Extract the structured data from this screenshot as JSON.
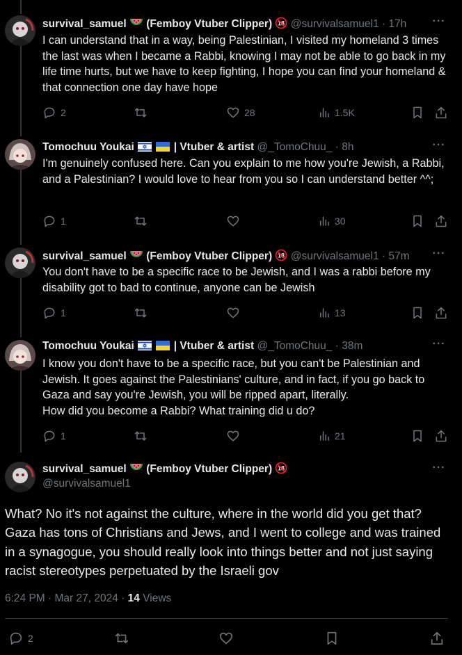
{
  "tweets": [
    {
      "name": "survival_samuel",
      "name_suffix": "(Femboy Vtuber Clipper)",
      "handle": "@survivalsamuel1",
      "time": "17h",
      "text": "I can understand that in a way, being Palestinian, I visited my homeland 3 times the last was when I became a Rabbi, knowing I may not be able to go back in my life time hurts, but  we have to keep fighting, I hope you can find your homeland & that connection one day have hope",
      "replies": "2",
      "likes": "28",
      "views": "1.5K"
    },
    {
      "name": "Tomochuu Youkai",
      "name_suffix": "| Vtuber & artist",
      "handle": "@_TomoChuu_",
      "time": "8h",
      "text": "I'm genuinely confused here. Can you explain to me how you're Jewish, a Rabbi, and a Palestinian? I would love to hear from you so I can understand better ^^;",
      "replies": "1",
      "likes": "",
      "views": "30"
    },
    {
      "name": "survival_samuel",
      "name_suffix": "(Femboy Vtuber Clipper)",
      "handle": "@survivalsamuel1",
      "time": "57m",
      "text": "You don't have to be a specific race to be Jewish, and I was a rabbi before my disability got to bad to continue, anyone can be Jewish",
      "replies": "1",
      "likes": "",
      "views": "13"
    },
    {
      "name": "Tomochuu Youkai",
      "name_suffix": "| Vtuber & artist",
      "handle": "@_TomoChuu_",
      "time": "38m",
      "text": "I know you don't have to be a specific race, but you can't be Palestinian and Jewish. It goes against the Palestinians' culture, and in fact, if you go back to Gaza and say you're Jewish, you will be ripped apart, literally.\nHow did you become a Rabbi? What training did u do?",
      "replies": "1",
      "likes": "",
      "views": "21"
    }
  ],
  "main_tweet": {
    "name": "survival_samuel",
    "name_suffix": "(Femboy Vtuber Clipper)",
    "handle": "@survivalsamuel1",
    "text": "What? No it's not against the culture, where in the world did you get that? Gaza has tons of Christians and Jews, and I went to college and was trained in a synagogue, you should really look into things better and not just saying racist stereotypes perpetuated by the Israeli gov",
    "timestamp": "6:24 PM · Mar 27, 2024",
    "views_count": "14",
    "views_label": "Views",
    "replies": "2"
  },
  "ui": {
    "more_label": "···",
    "dot_sep": "·"
  },
  "colors": {
    "background": "#000000",
    "text_primary": "#e7e9ea",
    "text_secondary": "#71767b",
    "thread_line": "#333639"
  },
  "icons": [
    "reply-icon",
    "retweet-icon",
    "like-icon",
    "views-icon",
    "bookmark-icon",
    "share-icon",
    "watermelon-icon",
    "no-under-18-icon",
    "israel-flag-icon",
    "ukraine-flag-icon",
    "more-icon"
  ]
}
